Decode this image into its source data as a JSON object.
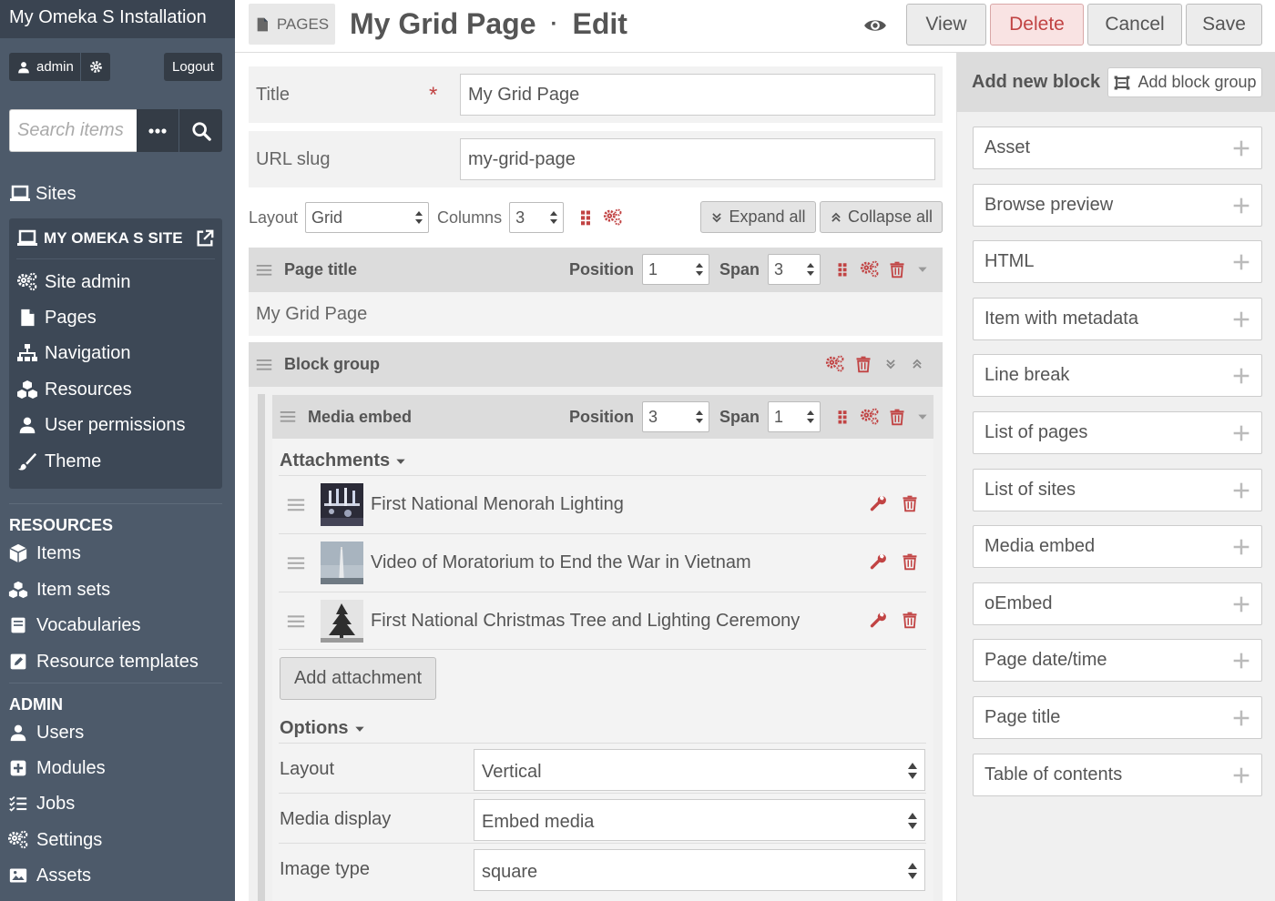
{
  "app": {
    "title": "My Omeka S Installation"
  },
  "user": {
    "name": "admin",
    "logout_label": "Logout"
  },
  "search": {
    "placeholder": "Search items"
  },
  "sidebar": {
    "sites_label": "Sites",
    "site_name": "MY OMEKA S SITE",
    "site_nav": [
      {
        "label": "Site admin",
        "icon": "cogs-icon"
      },
      {
        "label": "Pages",
        "icon": "file-icon"
      },
      {
        "label": "Navigation",
        "icon": "sitemap-icon"
      },
      {
        "label": "Resources",
        "icon": "cubes-icon"
      },
      {
        "label": "User permissions",
        "icon": "user-icon"
      },
      {
        "label": "Theme",
        "icon": "paint-brush-icon"
      }
    ],
    "resources_heading": "RESOURCES",
    "resources": [
      {
        "label": "Items",
        "icon": "cube-icon"
      },
      {
        "label": "Item sets",
        "icon": "cubes-icon"
      },
      {
        "label": "Vocabularies",
        "icon": "book-icon"
      },
      {
        "label": "Resource templates",
        "icon": "edit-icon"
      }
    ],
    "admin_heading": "ADMIN",
    "admin": [
      {
        "label": "Users",
        "icon": "user-icon"
      },
      {
        "label": "Modules",
        "icon": "plus-square-icon"
      },
      {
        "label": "Jobs",
        "icon": "tasks-icon"
      },
      {
        "label": "Settings",
        "icon": "cogs-icon"
      },
      {
        "label": "Assets",
        "icon": "image-icon"
      }
    ]
  },
  "header": {
    "breadcrumb": "PAGES",
    "page_title": "My Grid Page",
    "separator": "·",
    "mode": "Edit",
    "buttons": {
      "view": "View",
      "delete": "Delete",
      "cancel": "Cancel",
      "save": "Save"
    }
  },
  "form": {
    "title_label": "Title",
    "required_mark": "*",
    "title_value": "My Grid Page",
    "slug_label": "URL slug",
    "slug_value": "my-grid-page",
    "layout_label": "Layout",
    "layout_value": "Grid",
    "columns_label": "Columns",
    "columns_value": "3",
    "expand_all": "Expand all",
    "collapse_all": "Collapse all"
  },
  "blocks": {
    "page_title_block": {
      "title": "Page title",
      "position_label": "Position",
      "position_value": "1",
      "span_label": "Span",
      "span_value": "3",
      "body_text": "My Grid Page"
    },
    "block_group": {
      "title": "Block group"
    },
    "media_embed": {
      "title": "Media embed",
      "position_label": "Position",
      "position_value": "3",
      "span_label": "Span",
      "span_value": "1",
      "attachments_heading": "Attachments",
      "attachments": [
        {
          "title": "First National Menorah Lighting"
        },
        {
          "title": "Video of Moratorium to End the War in Vietnam"
        },
        {
          "title": "First National Christmas Tree and Lighting Ceremony"
        }
      ],
      "add_attachment_label": "Add attachment",
      "options_heading": "Options",
      "options": [
        {
          "label": "Layout",
          "value": "Vertical"
        },
        {
          "label": "Media display",
          "value": "Embed media"
        },
        {
          "label": "Image type",
          "value": "square"
        }
      ]
    }
  },
  "right_panel": {
    "heading": "Add new block",
    "add_group_label": "Add block group",
    "block_types": [
      "Asset",
      "Browse preview",
      "HTML",
      "Item with metadata",
      "Line break",
      "List of pages",
      "List of sites",
      "Media embed",
      "oEmbed",
      "Page date/time",
      "Page title",
      "Table of contents"
    ]
  },
  "colors": {
    "sidebar_bg": "#4d5a6a",
    "accent_red": "#c14343",
    "panel_gray": "#dcdcdc"
  }
}
